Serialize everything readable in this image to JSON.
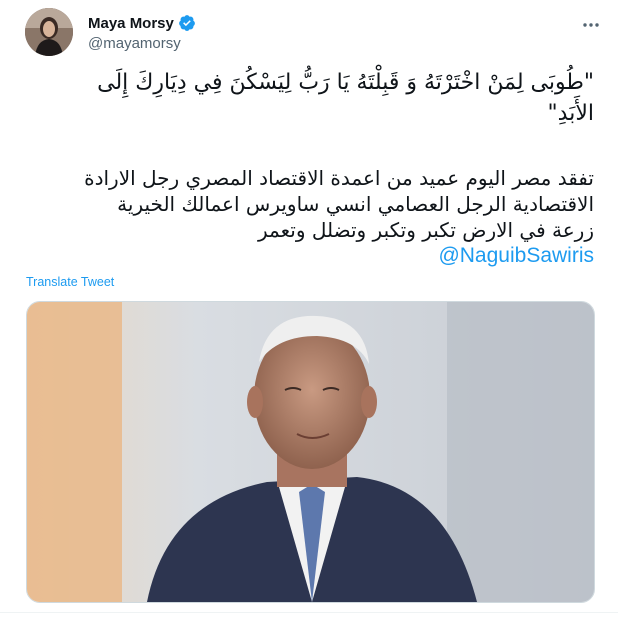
{
  "author": {
    "display_name": "Maya Morsy",
    "handle": "@mayamorsy",
    "verified": true
  },
  "tweet": {
    "quote_line_1": "\"طُوبَى لِمَنْ اخْتَرْتَهُ وَ قَبِلْتَهُ يَا رَبُّ لِيَسْكُنَ فِي دِيَارِكَ إِلَى",
    "quote_line_2": "الأَبَدِ\"",
    "body_line_1": "تفقد مصر اليوم عميد من اعمدة الاقتصاد المصري رجل الارادة",
    "body_line_2": "الاقتصادية الرجل العصامي انسي ساويرس اعمالك الخيرية",
    "body_line_3": "زرعة في الارض تكبر وتكبر وتضلل وتعمر",
    "mention": "@NaguibSawiris"
  },
  "translate_link": "Translate Tweet",
  "colors": {
    "link": "#1d9bf0",
    "verified": "#1d9bf0",
    "secondary_text": "#536471"
  },
  "icons": [
    "verified-badge-icon",
    "more-options-icon"
  ]
}
